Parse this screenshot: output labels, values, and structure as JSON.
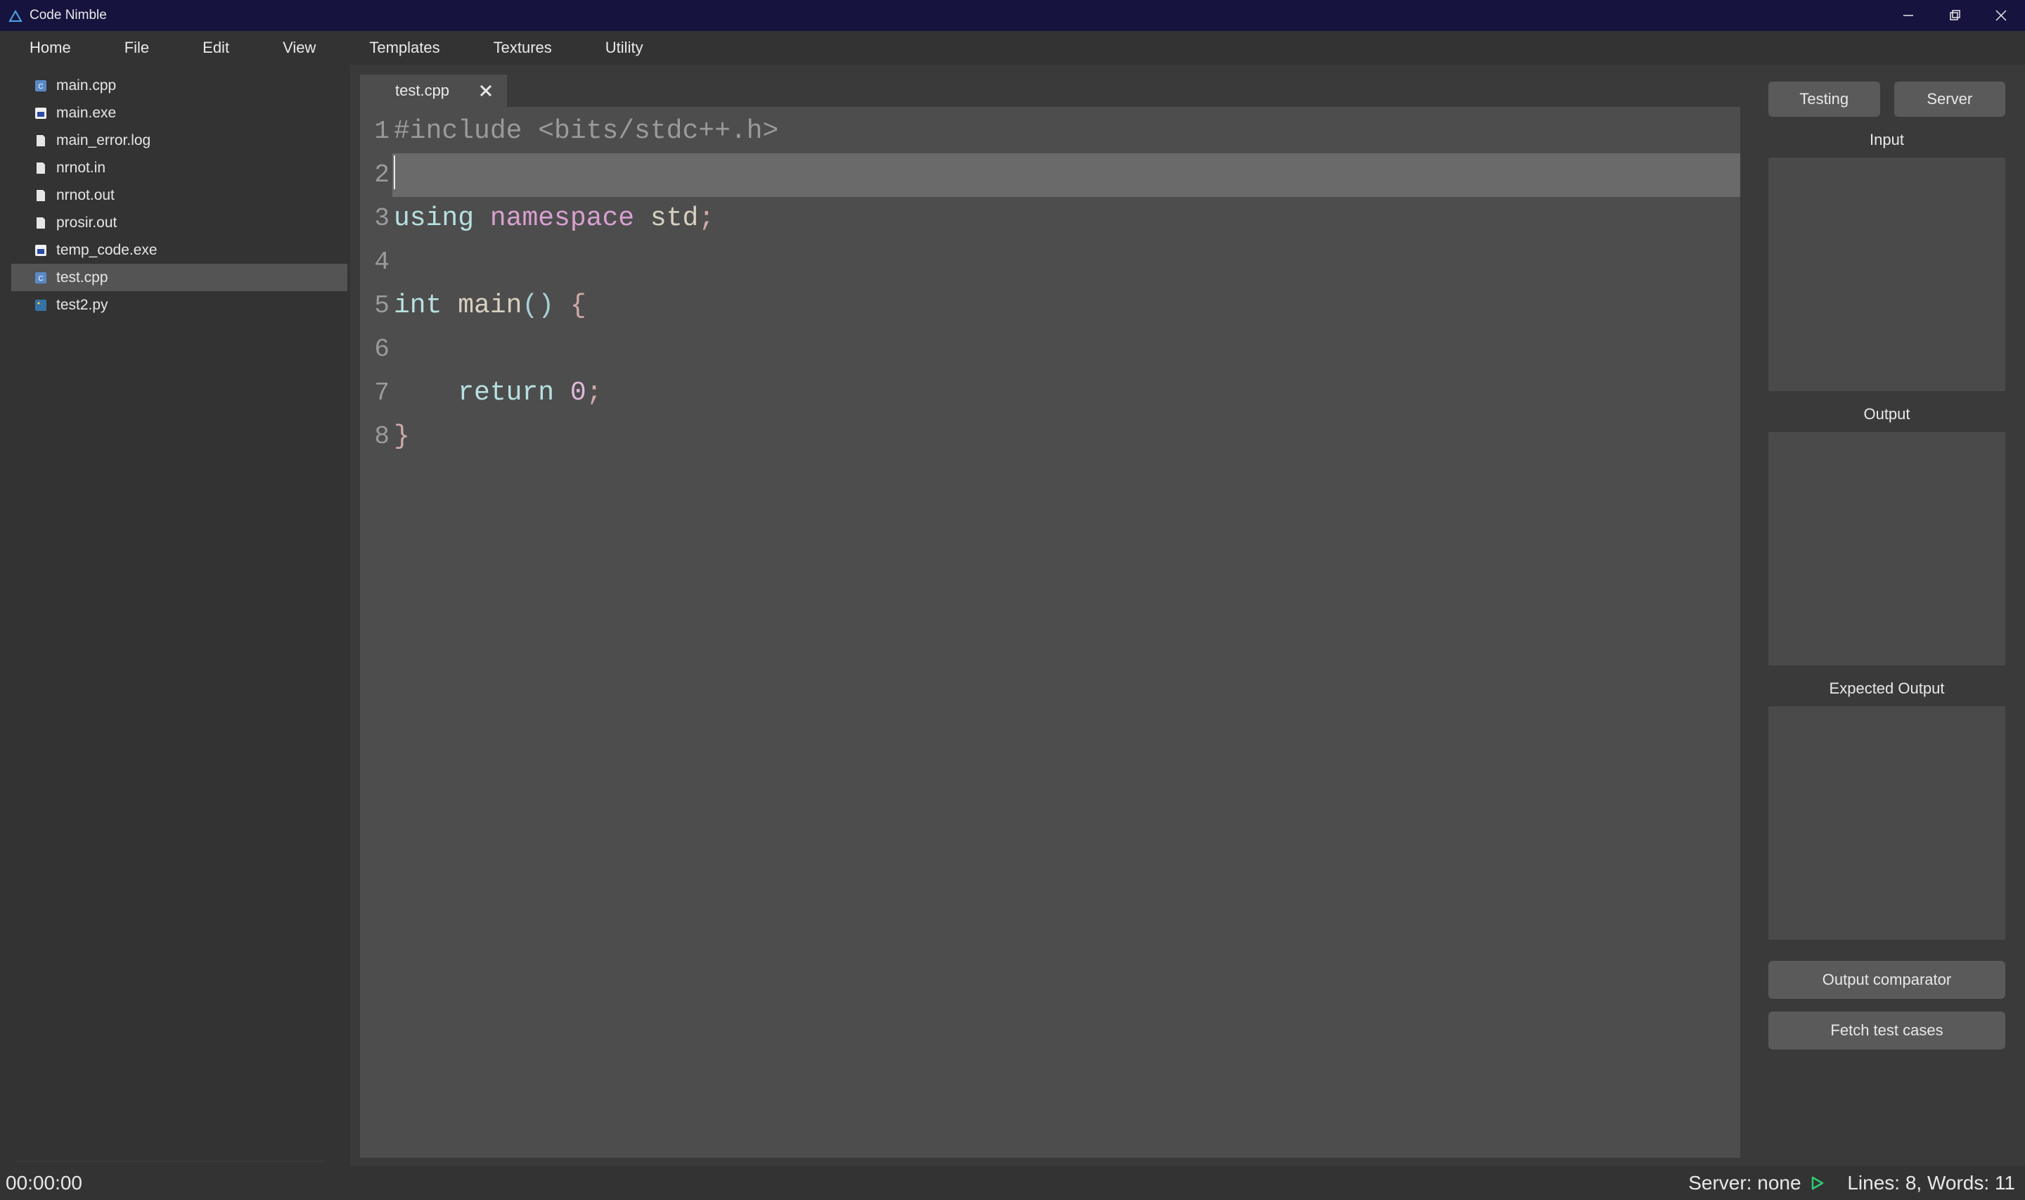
{
  "titlebar": {
    "app_name": "Code Nimble"
  },
  "menu": {
    "items": [
      {
        "label": "Home"
      },
      {
        "label": "File"
      },
      {
        "label": "Edit"
      },
      {
        "label": "View"
      },
      {
        "label": "Templates"
      },
      {
        "label": "Textures"
      },
      {
        "label": "Utility"
      }
    ]
  },
  "files": [
    {
      "name": "main.cpp",
      "icon": "cpp",
      "selected": false
    },
    {
      "name": "main.exe",
      "icon": "exe",
      "selected": false
    },
    {
      "name": "main_error.log",
      "icon": "plain",
      "selected": false
    },
    {
      "name": "nrnot.in",
      "icon": "plain",
      "selected": false
    },
    {
      "name": "nrnot.out",
      "icon": "plain",
      "selected": false
    },
    {
      "name": "prosir.out",
      "icon": "plain",
      "selected": false
    },
    {
      "name": "temp_code.exe",
      "icon": "exe",
      "selected": false
    },
    {
      "name": "test.cpp",
      "icon": "cpp",
      "selected": true
    },
    {
      "name": "test2.py",
      "icon": "py",
      "selected": false
    }
  ],
  "tabs": [
    {
      "label": "test.cpp",
      "active": true
    }
  ],
  "editor": {
    "current_line": 2,
    "lines": [
      [
        {
          "t": "#include <bits/stdc++.h>",
          "c": "pre"
        }
      ],
      [],
      [
        {
          "t": "using",
          "c": "kw"
        },
        {
          "t": " ",
          "c": "plain"
        },
        {
          "t": "namespace",
          "c": "kw2"
        },
        {
          "t": " ",
          "c": "plain"
        },
        {
          "t": "std",
          "c": "id"
        },
        {
          "t": ";",
          "c": "punc"
        }
      ],
      [],
      [
        {
          "t": "int",
          "c": "kw"
        },
        {
          "t": " ",
          "c": "plain"
        },
        {
          "t": "main",
          "c": "id"
        },
        {
          "t": "()",
          "c": "punc2"
        },
        {
          "t": " ",
          "c": "plain"
        },
        {
          "t": "{",
          "c": "punc"
        }
      ],
      [],
      [
        {
          "t": "    ",
          "c": "plain"
        },
        {
          "t": "return",
          "c": "kw"
        },
        {
          "t": " ",
          "c": "plain"
        },
        {
          "t": "0",
          "c": "num"
        },
        {
          "t": ";",
          "c": "punc"
        }
      ],
      [
        {
          "t": "}",
          "c": "punc"
        }
      ]
    ]
  },
  "right": {
    "testing_label": "Testing",
    "server_label": "Server",
    "input_label": "Input",
    "output_label": "Output",
    "expected_label": "Expected Output",
    "output_comparator_label": "Output comparator",
    "fetch_test_cases_label": "Fetch test cases"
  },
  "status": {
    "timer": "00:00:00",
    "server_text": "Server: none",
    "lines_words": "Lines: 8, Words: 11"
  }
}
